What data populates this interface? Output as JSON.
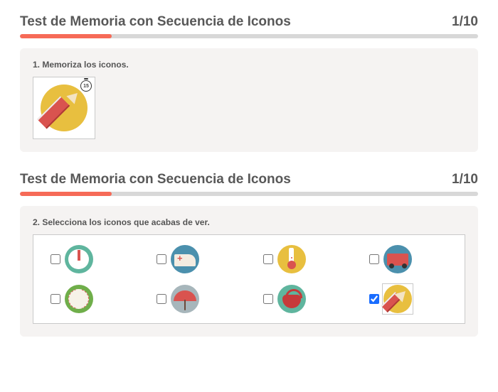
{
  "phase1": {
    "title": "Test de Memoria con Secuencia de Iconos",
    "counter": "1/10",
    "progress_pct": 20,
    "instruction": "1. Memoriza los iconos.",
    "timer": "15",
    "memorize_icon": "pencil-icon"
  },
  "phase2": {
    "title": "Test de Memoria con Secuencia de Iconos",
    "counter": "1/10",
    "progress_pct": 20,
    "instruction": "2. Selecciona los iconos que acabas de ver.",
    "choices": [
      {
        "icon": "clock-icon",
        "checked": false
      },
      {
        "icon": "ambulance-icon",
        "checked": false
      },
      {
        "icon": "thermometer-icon",
        "checked": false
      },
      {
        "icon": "truck-icon",
        "checked": false
      },
      {
        "icon": "baseball-icon",
        "checked": false
      },
      {
        "icon": "umbrella-icon",
        "checked": false
      },
      {
        "icon": "bag-icon",
        "checked": false
      },
      {
        "icon": "pencil-icon",
        "checked": true
      }
    ]
  }
}
